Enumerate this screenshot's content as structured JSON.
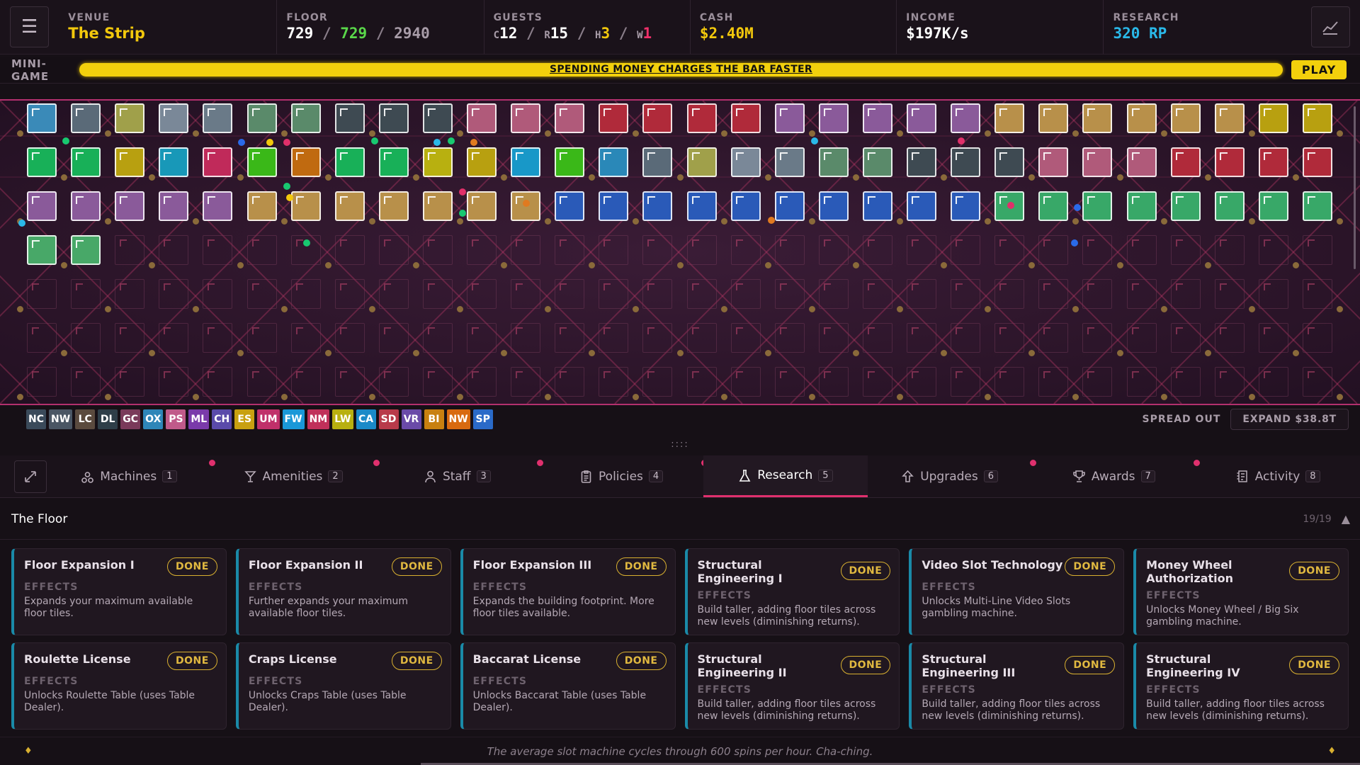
{
  "topbar": {
    "menu_icon": "hamburger-icon",
    "venue": {
      "label": "VENUE",
      "value": "The Strip"
    },
    "floor": {
      "label": "FLOOR",
      "a": "729",
      "b": "729",
      "c": "2940",
      "sep": "/"
    },
    "guests": {
      "label": "GUESTS",
      "c_prefix": "C",
      "c": "12",
      "r_prefix": "R",
      "r": "15",
      "h_prefix": "H",
      "h": "3",
      "w_prefix": "W",
      "w": "1",
      "sep": "/"
    },
    "cash": {
      "label": "CASH",
      "value": "$2.40M"
    },
    "income": {
      "label": "INCOME",
      "value": "$197K/s"
    },
    "research": {
      "label": "RESEARCH",
      "value": "320 RP"
    },
    "chart_icon": "stats-chart-icon"
  },
  "minigame": {
    "label": "MINI-GAME",
    "bar_text": "SPENDING MONEY CHARGES THE BAR FASTER",
    "progress": 1.0,
    "play_label": "PLAY"
  },
  "legend": {
    "codes": [
      {
        "code": "NC",
        "color": "#3a4a5a"
      },
      {
        "code": "NW",
        "color": "#4a5664"
      },
      {
        "code": "LC",
        "color": "#5a4a3e"
      },
      {
        "code": "DL",
        "color": "#2e3e48"
      },
      {
        "code": "GC",
        "color": "#7a3a5a"
      },
      {
        "code": "OX",
        "color": "#2e86b8"
      },
      {
        "code": "PS",
        "color": "#c05a8a"
      },
      {
        "code": "ML",
        "color": "#7a3aaa"
      },
      {
        "code": "CH",
        "color": "#5a4aaa"
      },
      {
        "code": "ES",
        "color": "#c8a010"
      },
      {
        "code": "UM",
        "color": "#c0306a"
      },
      {
        "code": "FW",
        "color": "#1a98d8"
      },
      {
        "code": "NM",
        "color": "#c0305a"
      },
      {
        "code": "LW",
        "color": "#b8b010"
      },
      {
        "code": "CA",
        "color": "#1a8ac8"
      },
      {
        "code": "SD",
        "color": "#b83a4a"
      },
      {
        "code": "VR",
        "color": "#6a4aa8"
      },
      {
        "code": "BI",
        "color": "#c88010"
      },
      {
        "code": "NW",
        "color": "#d86a10"
      },
      {
        "code": "SP",
        "color": "#2a6ac8"
      }
    ],
    "spread_label": "SPREAD OUT",
    "expand_label": "EXPAND $38.8T"
  },
  "divider": "::::",
  "tabs": [
    {
      "label": "Machines",
      "count": "1",
      "icon": "machines-icon",
      "pip": true
    },
    {
      "label": "Amenities",
      "count": "2",
      "icon": "cocktail-icon",
      "pip": true
    },
    {
      "label": "Staff",
      "count": "3",
      "icon": "person-icon",
      "pip": true
    },
    {
      "label": "Policies",
      "count": "4",
      "icon": "clipboard-icon",
      "pip": true
    },
    {
      "label": "Research",
      "count": "5",
      "icon": "flask-icon",
      "pip": false,
      "active": true
    },
    {
      "label": "Upgrades",
      "count": "6",
      "icon": "arrow-up-icon",
      "pip": true
    },
    {
      "label": "Awards",
      "count": "7",
      "icon": "trophy-icon",
      "pip": true
    },
    {
      "label": "Activity",
      "count": "8",
      "icon": "log-icon",
      "pip": false
    }
  ],
  "section": {
    "title": "The Floor",
    "count": "19/19"
  },
  "cards": [
    {
      "title": "Floor Expansion I",
      "status": "DONE",
      "effects_label": "EFFECTS",
      "desc": "Expands your maximum available floor tiles."
    },
    {
      "title": "Floor Expansion II",
      "status": "DONE",
      "effects_label": "EFFECTS",
      "desc": "Further expands your maximum available floor tiles."
    },
    {
      "title": "Floor Expansion III",
      "status": "DONE",
      "effects_label": "EFFECTS",
      "desc": "Expands the building footprint. More floor tiles available."
    },
    {
      "title": "Structural Engineering I",
      "status": "DONE",
      "effects_label": "EFFECTS",
      "desc": "Build taller, adding floor tiles across new levels (diminishing returns)."
    },
    {
      "title": "Video Slot Technology",
      "status": "DONE",
      "effects_label": "EFFECTS",
      "desc": "Unlocks Multi-Line Video Slots gambling machine."
    },
    {
      "title": "Money Wheel Authorization",
      "status": "DONE",
      "effects_label": "EFFECTS",
      "desc": "Unlocks Money Wheel / Big Six gambling machine."
    },
    {
      "title": "Roulette License",
      "status": "DONE",
      "effects_label": "EFFECTS",
      "desc": "Unlocks Roulette Table (uses Table Dealer)."
    },
    {
      "title": "Craps License",
      "status": "DONE",
      "effects_label": "EFFECTS",
      "desc": "Unlocks Craps Table (uses Table Dealer)."
    },
    {
      "title": "Baccarat License",
      "status": "DONE",
      "effects_label": "EFFECTS",
      "desc": "Unlocks Baccarat Table (uses Table Dealer)."
    },
    {
      "title": "Structural Engineering II",
      "status": "DONE",
      "effects_label": "EFFECTS",
      "desc": "Build taller, adding floor tiles across new levels (diminishing returns)."
    },
    {
      "title": "Structural Engineering III",
      "status": "DONE",
      "effects_label": "EFFECTS",
      "desc": "Build taller, adding floor tiles across new levels (diminishing returns)."
    },
    {
      "title": "Structural Engineering IV",
      "status": "DONE",
      "effects_label": "EFFECTS",
      "desc": "Build taller, adding floor tiles across new levels (diminishing returns)."
    }
  ],
  "footer": {
    "tip": "The average slot machine cycles through 600 spins per hour. Cha-ching."
  },
  "floor_tiles": [
    [
      "#3a8ab8",
      "#5a6a78",
      "#a0a04a",
      "#7a8898",
      "#6a7a88",
      "#5a8a6a",
      "#5a8a6a",
      "#3e4a52",
      "#3e4a52",
      "#3e4a52",
      "#b05a7a",
      "#b05a7a",
      "#b05a7a",
      "#b02a3a",
      "#b02a3a",
      "#b02a3a",
      "#b02a3a",
      "#8a5a9a",
      "#8a5a9a",
      "#8a5a9a",
      "#8a5a9a",
      "#8a5a9a",
      "#b8904a",
      "#b8904a",
      "#b8904a",
      "#b8904a",
      "#b8904a",
      "#b8904a",
      "#b8a010",
      "#b8a010"
    ],
    [
      "#18b058",
      "#18b058",
      "#b8a010",
      "#1898b8",
      "#c02a5a",
      "#3ab818",
      "#c06a10",
      "#18b058",
      "#18b058",
      "#b8b010",
      "#b8a010",
      "#1898c8",
      "#3ab818",
      "#2a88b8",
      "#5a6a78",
      "#a0a04a",
      "#7a8898",
      "#6a7a88",
      "#5a8a6a",
      "#5a8a6a",
      "#3e4a52",
      "#3e4a52",
      "#3e4a52",
      "#b05a7a",
      "#b05a7a",
      "#b05a7a",
      "#b02a3a",
      "#b02a3a",
      "#b02a3a",
      "#b02a3a"
    ],
    [
      "#8a5a9a",
      "#8a5a9a",
      "#8a5a9a",
      "#8a5a9a",
      "#8a5a9a",
      "#b8904a",
      "#b8904a",
      "#b8904a",
      "#b8904a",
      "#b8904a",
      "#b8904a",
      "#b8904a",
      "#2a5ab8",
      "#2a5ab8",
      "#2a5ab8",
      "#2a5ab8",
      "#2a5ab8",
      "#2a5ab8",
      "#2a5ab8",
      "#2a5ab8",
      "#2a5ab8",
      "#2a5ab8",
      "#38a868",
      "#38a868",
      "#38a868",
      "#38a868",
      "#38a868",
      "#38a868",
      "#38a868",
      "#38a868"
    ],
    [
      "#48a868",
      "#48a868"
    ]
  ]
}
